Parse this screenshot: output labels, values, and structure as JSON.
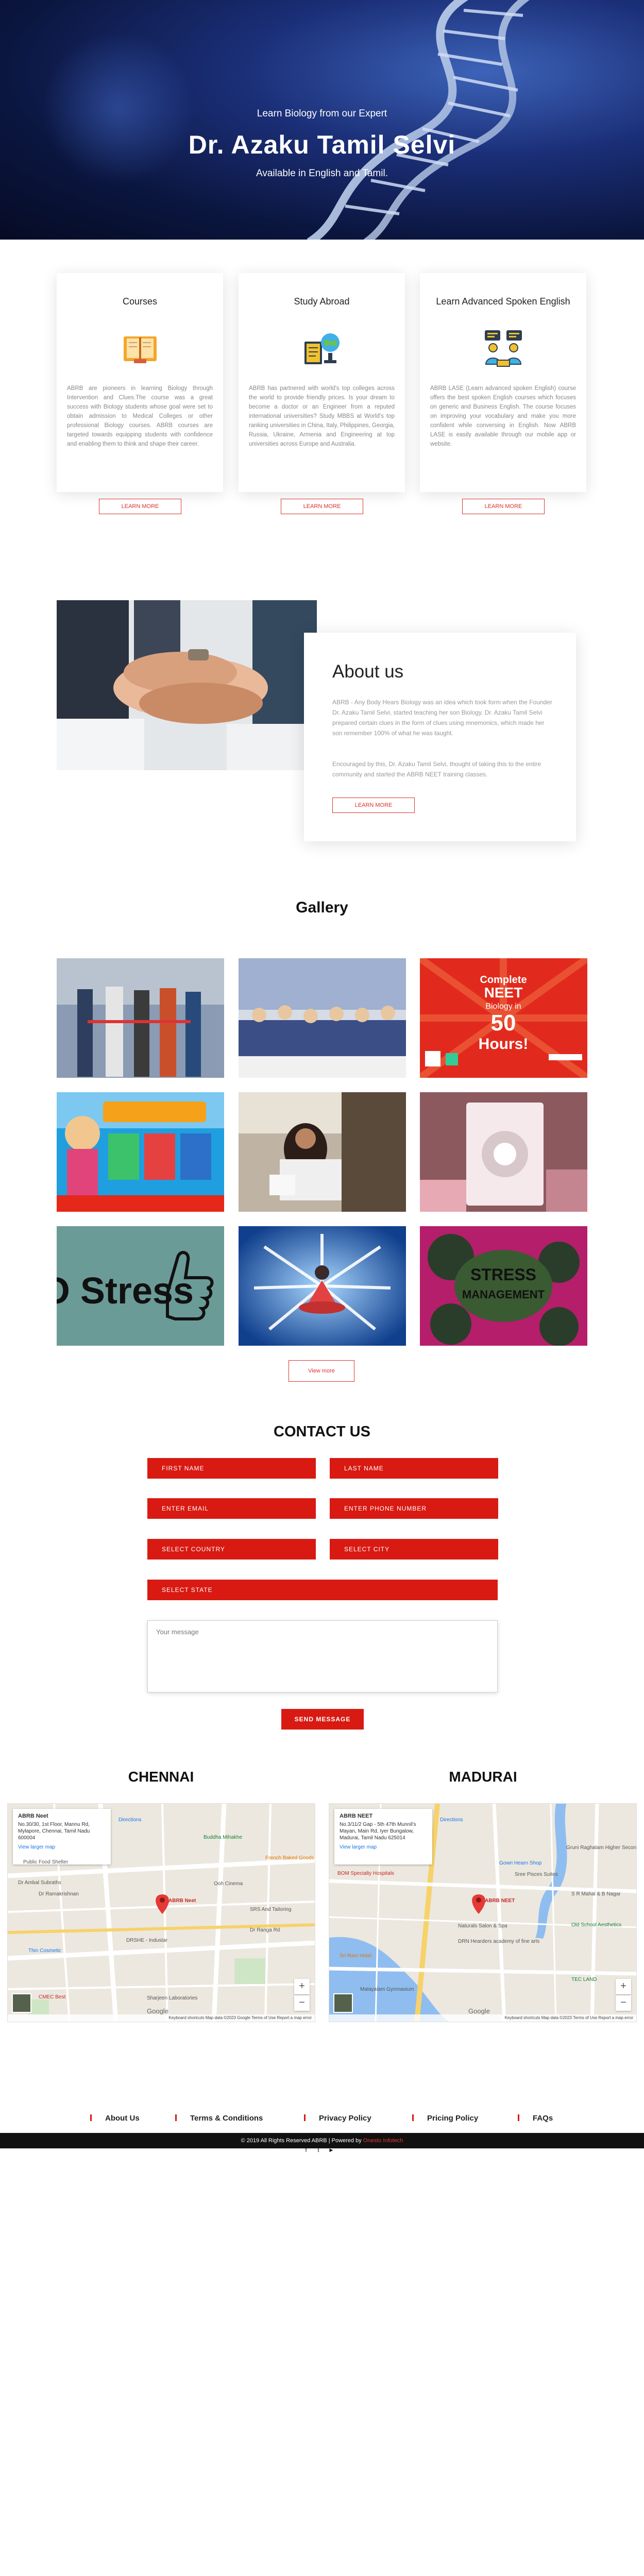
{
  "hero": {
    "tagline": "Learn Biology from our Expert",
    "title": "Dr. Azaku Tamil Selvi",
    "subtitle": "Available in English and Tamil."
  },
  "services": [
    {
      "title": "Courses",
      "icon": "book-icon",
      "description": "ABRB are pioneers in learning Biology through Intervention and Clues.The course was a great success with Biology students whose goal were set to obtain admission to Medical Colleges or other professional Biology courses. ABRB courses are targeted towards equipping students with confidence and enabling them to think and shape their career.",
      "button": "LEARN MORE"
    },
    {
      "title": "Study Abroad",
      "icon": "study-globe-icon",
      "description": "ABRB has partnered with world's top colleges across the world to provide friendly prices. Is your dream to become a doctor or an Engineer from a reputed international universities? Study MBBS at World's top ranking universities in China, Italy, Philippines, Georgia, Russia, Ukraine, Armenia and Engineering at top universities across Europe and Australia.",
      "button": "LEARN MORE"
    },
    {
      "title": "Learn Advanced Spoken English",
      "icon": "speaking-people-icon",
      "description": "ABRB LASE (Learn advanced spoken English) course offers the best spoken English courses which focuses on generic and Business English. The course focuses on improving your vocabulary and make you more confident while conversing in English. Now ABRB LASE is easily available through our mobile app or website.",
      "button": "LEARN MORE"
    }
  ],
  "about": {
    "title": "About us",
    "p1": "ABRB - Any Body Hears Biology was an idea which took form when the Founder Dr. Azaku Tamil Selvi, started teaching her son Biology. Dr. Azaku Tamil Selvi prepared certain clues in the form of clues using mnemonics, which made her son remember 100% of what he was taught.",
    "p2": "Encouraged by this, Dr. Azaku Tamil Selvi, thought of taking this to the entire community and started the ABRB NEET training classes.",
    "button": "LEARN MORE"
  },
  "gallery": {
    "title": "Gallery",
    "poster_neet": {
      "l1": "Complete",
      "l2": "NEET",
      "l3": "Biology in",
      "l4": "50",
      "l5": "Hours!"
    },
    "poster_nostress": "NO Stress",
    "poster_stress": {
      "l1": "STRESS",
      "l2": "MANAGEMENT"
    },
    "view_more": "View more"
  },
  "contact": {
    "title": "CONTACT US",
    "first_name": "FIRST NAME",
    "last_name": "LAST NAME",
    "email": "ENTER EMAIL",
    "phone": "ENTER PHONE NUMBER",
    "country": "SELECT COUNTRY",
    "city": "SELECT CITY",
    "state": "SELECT STATE",
    "message_placeholder": "Your message",
    "send": "SEND MESSAGE"
  },
  "locations": [
    {
      "city": "CHENNAI",
      "name": "ABRB Neet",
      "address": "No.30/30, 1st Floor, Mannu Rd, Mylapore, Chennai, Tamil Nadu 600004",
      "directions": "Directions",
      "larger": "View larger map",
      "pin": "ABRB Neet",
      "labels": [
        "Buddha Mihakhe",
        "Public Food Shelter",
        "Dr Ambal Subraths",
        "Dr Ramakrishnan",
        "DRSHE - Industar",
        "Thin Cosmetic",
        "Ooh Cinema",
        "SRS And Tailoring",
        "French Baked Goods",
        "Sharjeen Laboratories",
        "Dr Ranga Rd",
        "CMEC Best",
        "Google"
      ],
      "footer": "Keyboard shortcuts  Map data ©2023 Google  Terms of Use  Report a map error"
    },
    {
      "city": "MADURAI",
      "name": "ABRB NEET",
      "address": "No.3/11/2 Gap - 5th 47th Munnil's Mayan, Main Rd, Iyer Bungalow, Madurai, Tamil Nadu 625014",
      "directions": "Directions",
      "larger": "View larger map",
      "pin": "ABRB NEET",
      "labels": [
        "BOM Specialty Hospitals",
        "Gowri Hearn Shop",
        "Sree Pisces Suites",
        "Naturals Salon & Spa",
        "DRN Hearders academy of fine arts",
        "Sri Ram Hotel",
        "Malayalam Gymnasium",
        "Gruni Raghalam Higher Secondary School",
        "S R Mahal & B Nagar",
        "Old School Aesthetics",
        "TEC LAND",
        "Google"
      ],
      "footer": "Keyboard shortcuts  Map data ©2023  Terms of Use  Report a map error"
    }
  ],
  "footer": {
    "links": [
      "About Us",
      "Terms & Conditions",
      "Privacy Policy",
      "Pricing Policy",
      "FAQs"
    ],
    "social": [
      "f",
      "t",
      "▶"
    ],
    "copyright": "© 2019 All Rights Reserved ABRB | Powered by",
    "powered_by": "Onesto Infotech"
  },
  "colors": {
    "accent": "#d81a12",
    "hero_dark": "#0b1640"
  }
}
